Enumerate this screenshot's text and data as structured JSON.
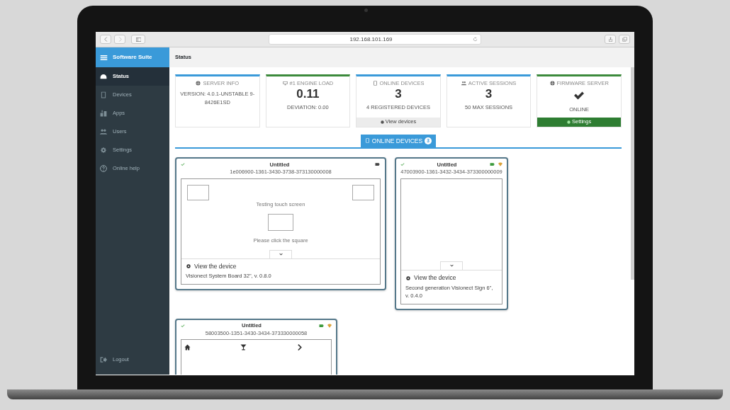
{
  "browser": {
    "url": "192.168.101.169"
  },
  "sidebar": {
    "title": "Software Suite",
    "items": [
      {
        "label": "Status",
        "selected": true
      },
      {
        "label": "Devices",
        "selected": false
      },
      {
        "label": "Apps",
        "selected": false
      },
      {
        "label": "Users",
        "selected": false
      },
      {
        "label": "Settings",
        "selected": false
      },
      {
        "label": "Online help",
        "selected": false
      }
    ],
    "logout": "Logout"
  },
  "header": {
    "title": "Status"
  },
  "stats": [
    {
      "title": "SERVER INFO",
      "color": "#3a9ad9",
      "kind": "info",
      "subtitle": "VERSION: 4.0.1-UNSTABLE 9-8426E1SD"
    },
    {
      "title": "#1 ENGINE LOAD",
      "color": "#3c8a3c",
      "kind": "number",
      "value": "0.11",
      "subtitle": "DEVIATION: 0.00"
    },
    {
      "title": "ONLINE DEVICES",
      "color": "#3a9ad9",
      "kind": "number",
      "value": "3",
      "subtitle": "4 REGISTERED DEVICES",
      "footer": {
        "label": "View devices",
        "kind": "default"
      }
    },
    {
      "title": "ACTIVE SESSIONS",
      "color": "#3a9ad9",
      "kind": "number",
      "value": "3",
      "subtitle": "50 MAX SESSIONS"
    },
    {
      "title": "FIRMWARE SERVER",
      "color": "#3c8a3c",
      "kind": "check",
      "subtitle": "ONLINE",
      "footer": {
        "label": "Settings",
        "kind": "success"
      }
    }
  ],
  "section": {
    "label": "ONLINE DEVICES",
    "count": "3"
  },
  "devices": [
    {
      "kind": "board",
      "title": "Untitled",
      "id": "1e006900-1361-3430-3738-373130000008",
      "wifi": false,
      "texts": [
        "Testing touch screen",
        "Please click the square"
      ],
      "link": "View the device",
      "description": "Visionect System Board 32\", v. 0.8.0"
    },
    {
      "kind": "sign",
      "title": "Untitled",
      "id": "47003900-1361-3432-3434-373300000009",
      "wifi": true,
      "link": "View the device",
      "description": "Second generation Visionect Sign 6\", v. 0.4.0"
    },
    {
      "kind": "app",
      "title": "Untitled",
      "id": "58003500-1351-3430-3434-373330000058",
      "wifi": true
    }
  ]
}
